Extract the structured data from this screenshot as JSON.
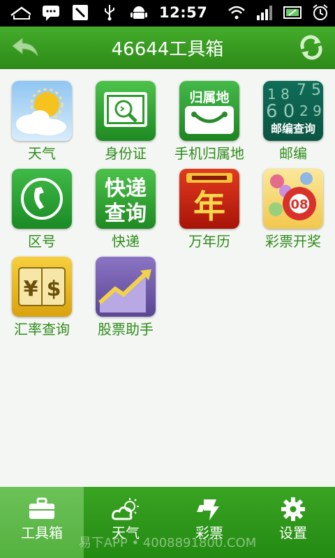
{
  "status_bar": {
    "time": "12:57",
    "left_icons": [
      "home-icon",
      "message-icon",
      "phone-icon",
      "usb-icon",
      "android-icon"
    ],
    "right_icons": [
      "wifi-icon",
      "signal-icon",
      "battery-icon",
      "alarm-icon"
    ]
  },
  "header": {
    "title": "46644工具箱",
    "back_icon": "back-arrow-icon",
    "refresh_icon": "refresh-icon"
  },
  "tools": [
    {
      "label": "天气",
      "icon": "weather-icon"
    },
    {
      "label": "身份证",
      "icon": "id-card-icon"
    },
    {
      "label": "手机归属地",
      "icon": "phone-location-icon",
      "icon_text": "归属地"
    },
    {
      "label": "邮编",
      "icon": "postcode-icon",
      "icon_text": "邮编查询"
    },
    {
      "label": "区号",
      "icon": "area-code-icon"
    },
    {
      "label": "快递",
      "icon": "express-icon",
      "icon_text": "快递查询"
    },
    {
      "label": "万年历",
      "icon": "calendar-icon",
      "icon_text": "年"
    },
    {
      "label": "彩票开奖",
      "icon": "lottery-icon",
      "icon_text": "08"
    },
    {
      "label": "汇率查询",
      "icon": "exchange-rate-icon",
      "icon_text": "¥ $"
    },
    {
      "label": "股票助手",
      "icon": "stock-icon"
    }
  ],
  "tabs": [
    {
      "label": "工具箱",
      "icon": "toolbox-icon",
      "active": true
    },
    {
      "label": "天气",
      "icon": "weather-tab-icon",
      "active": false
    },
    {
      "label": "彩票",
      "icon": "lottery-tab-icon",
      "active": false
    },
    {
      "label": "设置",
      "icon": "gear-icon",
      "active": false
    }
  ],
  "watermark": "易下APP • 4008891800.COM",
  "colors": {
    "accent": "#2d8a18",
    "label": "#2e8b19"
  }
}
